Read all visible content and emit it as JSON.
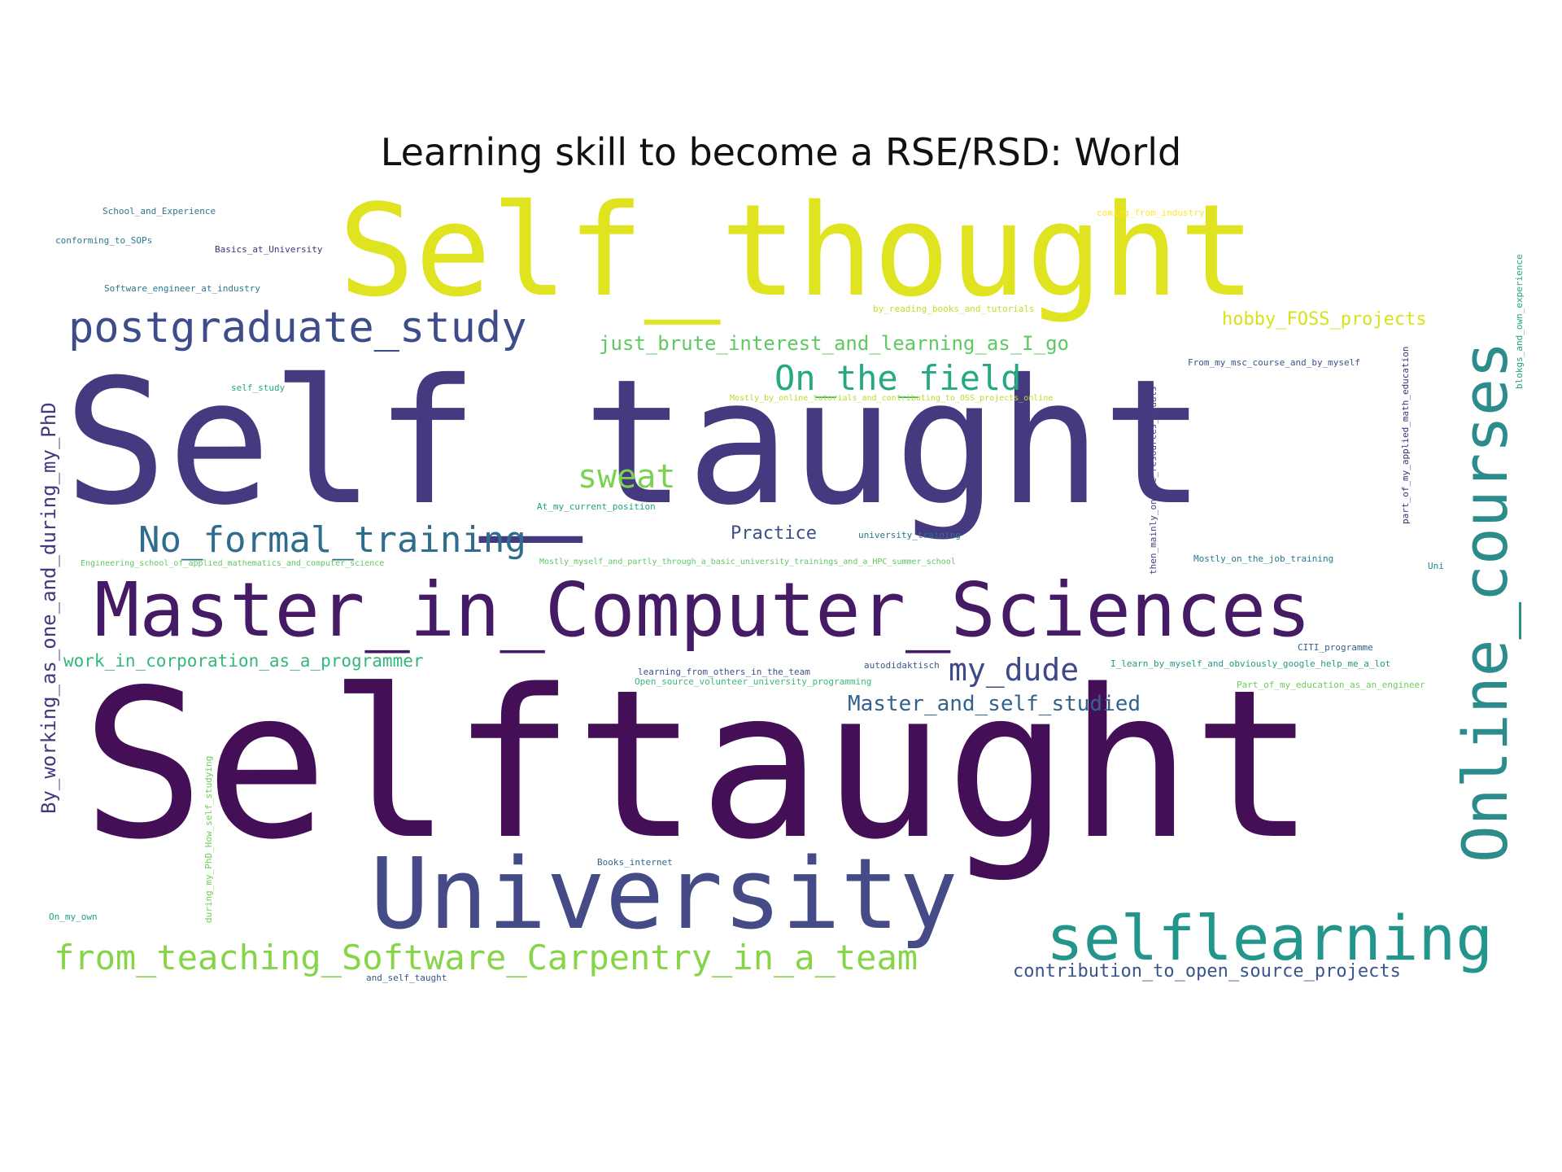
{
  "title": "Learning skill to become a RSE/RSD: World",
  "words": [
    {
      "text": "Selftaught",
      "color": "#440f56"
    },
    {
      "text": "Self_taught",
      "color": "#453a80"
    },
    {
      "text": "Self_thought",
      "color": "#e0e31f"
    },
    {
      "text": "Master_in_Computer_Sciences",
      "color": "#461b66"
    },
    {
      "text": "University",
      "color": "#454b87"
    },
    {
      "text": "Online_courses",
      "color": "#2b8c8b"
    },
    {
      "text": "selflearning",
      "color": "#23968b"
    },
    {
      "text": "postgraduate_study",
      "color": "#3e4c8a"
    },
    {
      "text": "No_formal_training",
      "color": "#2f6d8e"
    },
    {
      "text": "On_the_field",
      "color": "#25a982"
    },
    {
      "text": "from_teaching_Software_Carpentry_in_a_team",
      "color": "#86d549"
    },
    {
      "text": "By_working_as_one_and_during_my_PhD",
      "color": "#46377f"
    },
    {
      "text": "my_dude",
      "color": "#3e4989"
    },
    {
      "text": "sweat",
      "color": "#7cd250"
    },
    {
      "text": "just_brute_interest_and_learning_as_I_go",
      "color": "#5ec962"
    },
    {
      "text": "hobby_FOSS_projects",
      "color": "#d8e219"
    },
    {
      "text": "Master_and_self_studied",
      "color": "#33638d"
    },
    {
      "text": "contribution_to_open_source_projects",
      "color": "#3a548c"
    },
    {
      "text": "work_in_corporation_as_a_programmer",
      "color": "#35b779"
    },
    {
      "text": "Practice",
      "color": "#3d4e8a"
    },
    {
      "text": "School_and_Experience",
      "color": "#2a788e"
    },
    {
      "text": "conforming_to_SOPs",
      "color": "#2a788e"
    },
    {
      "text": "Basics_at_University",
      "color": "#472d7b"
    },
    {
      "text": "Software_engineer_at_industry",
      "color": "#2a788e"
    },
    {
      "text": "coming_from_industry",
      "color": "#fde725"
    },
    {
      "text": "by_reading_books_and_tutorials",
      "color": "#c2df23"
    },
    {
      "text": "self_study",
      "color": "#22a884"
    },
    {
      "text": "Mostly_by_online_tutorials_and_contributing_to_OSS_projects_online",
      "color": "#b5de2b"
    },
    {
      "text": "At_my_current_position",
      "color": "#1fa187"
    },
    {
      "text": "university_training",
      "color": "#2c728e"
    },
    {
      "text": "Engineering_school_of_applied_mathematics_and_computer_science",
      "color": "#5ec962"
    },
    {
      "text": "Mostly_myself_and_partly_through_a_basic_university_trainings_and_a_HPC_summer_school",
      "color": "#5ec962"
    },
    {
      "text": "From_my_msc_course_and_by_myself",
      "color": "#3b528b"
    },
    {
      "text": "Mostly_on_the_job_training",
      "color": "#2a788e"
    },
    {
      "text": "Uni",
      "color": "#25858e"
    },
    {
      "text": "CITI_programme",
      "color": "#34608d"
    },
    {
      "text": "I_learn_by_myself_and_obviously_google_help_me_a_lot",
      "color": "#1f998a"
    },
    {
      "text": "Part_of_my_education_as_an_engineer",
      "color": "#6ccd5a"
    },
    {
      "text": "learning_from_others_in_the_team",
      "color": "#3b528b"
    },
    {
      "text": "autodidaktisch",
      "color": "#38598c"
    },
    {
      "text": "Open_source_volunteer_university_programming",
      "color": "#3aba76"
    },
    {
      "text": "Books_internet",
      "color": "#31688e"
    },
    {
      "text": "and_self_taught",
      "color": "#3b528b"
    },
    {
      "text": "On_my_own",
      "color": "#1fa088"
    },
    {
      "text": "then_mainly_online_resources_mauals",
      "color": "#404387"
    },
    {
      "text": "part_of_my_applied_math_education",
      "color": "#472a7a"
    },
    {
      "text": "blokgs_and_own_experience",
      "color": "#20a486"
    },
    {
      "text": "during_my_PhD_How_self_studying",
      "color": "#6ece58"
    }
  ]
}
